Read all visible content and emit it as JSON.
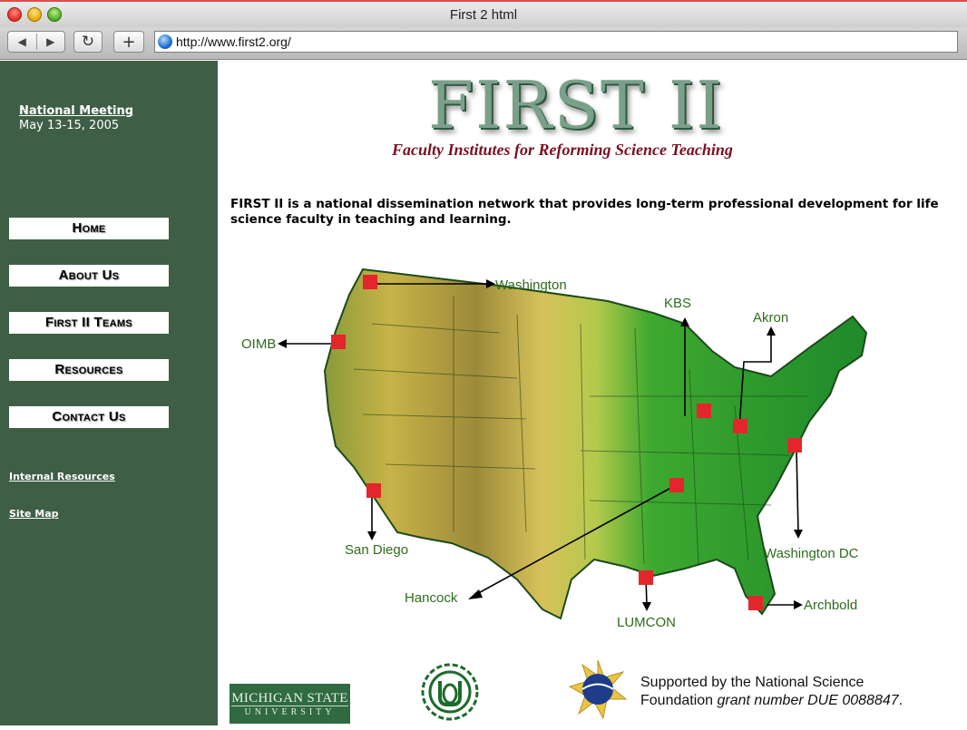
{
  "window": {
    "title": "First 2 html"
  },
  "toolbar": {
    "back_icon": "back-arrow-icon",
    "forward_icon": "forward-arrow-icon",
    "reload_icon": "reload-icon",
    "add_icon": "plus-icon",
    "url": "http://www.first2.org/"
  },
  "sidebar": {
    "meeting_title": "National Meeting",
    "meeting_dates": "May 13-15, 2005",
    "nav": [
      {
        "label": "Home"
      },
      {
        "label": "About Us"
      },
      {
        "label": "First II Teams"
      },
      {
        "label": "Resources"
      },
      {
        "label": "Contact Us"
      }
    ],
    "links": [
      {
        "label": "Internal Resources"
      },
      {
        "label": "Site Map"
      }
    ],
    "background_color": "#3e5f46"
  },
  "header": {
    "logo_text": "FIRST II",
    "logo_subtitle": "Faculty Institutes for Reforming Science Teaching",
    "subtitle_color": "#7a1020"
  },
  "intro": "FIRST II is a national dissemination network that provides long-term professional development for life science faculty in teaching and learning.",
  "map": {
    "labels": [
      "Washington",
      "OIMB",
      "KBS",
      "Akron",
      "San Diego",
      "Washington DC",
      "Hancock",
      "LUMCON",
      "Archbold"
    ]
  },
  "footer": {
    "msu_line1": "MICHIGAN STATE",
    "msu_line2": "UNIVERSITY",
    "support_line1": "Supported by the National Science",
    "support_line2_prefix": "Foundation ",
    "support_grant": "grant number DUE 0088847",
    "support_suffix": "."
  }
}
